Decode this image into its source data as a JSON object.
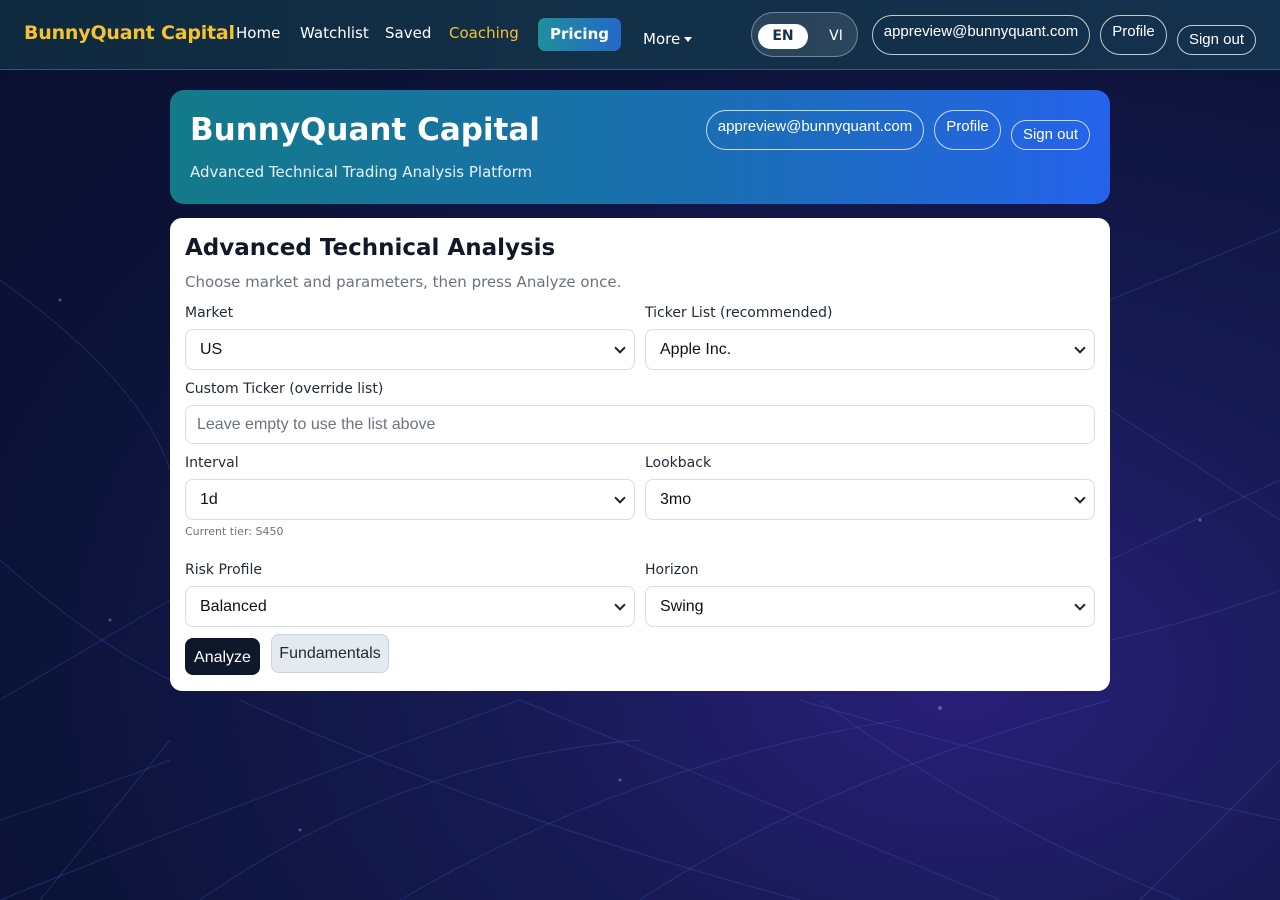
{
  "nav": {
    "brand": "BunnyQuant Capital",
    "links": [
      {
        "label": "Home"
      },
      {
        "label": "Watchlist"
      },
      {
        "label": "Saved"
      },
      {
        "label": "Coaching",
        "active": true
      }
    ],
    "pricing": "Pricing",
    "more": "More",
    "lang": {
      "en": "EN",
      "vi": "VI",
      "selected": "EN"
    },
    "email": "appreview@bunnyquant.com",
    "profile": "Profile",
    "sign_out": "Sign out"
  },
  "hero": {
    "title": "BunnyQuant Capital",
    "subtitle": "Advanced Technical Trading Analysis Platform",
    "email": "appreview@bunnyquant.com",
    "profile": "Profile",
    "sign_out": "Sign out"
  },
  "form": {
    "title": "Advanced Technical Analysis",
    "description": "Choose market and parameters, then press Analyze once.",
    "market": {
      "label": "Market",
      "value": "US"
    },
    "ticker_list": {
      "label": "Ticker List (recommended)",
      "value": "Apple Inc."
    },
    "custom_ticker": {
      "label": "Custom Ticker (override list)",
      "placeholder": "Leave empty to use the list above",
      "value": ""
    },
    "interval": {
      "label": "Interval",
      "value": "1d"
    },
    "lookback": {
      "label": "Lookback",
      "value": "3mo"
    },
    "tier_note": "Current tier: S450",
    "risk_profile": {
      "label": "Risk Profile",
      "value": "Balanced"
    },
    "horizon": {
      "label": "Horizon",
      "value": "Swing"
    },
    "analyze": "Analyze",
    "fundamentals": "Fundamentals"
  },
  "colors": {
    "brand": "#f5c232",
    "nav_bg": "#13304d",
    "hero_start": "#137a8a",
    "hero_end": "#2563eb",
    "analyze_bg": "#0f172a"
  }
}
